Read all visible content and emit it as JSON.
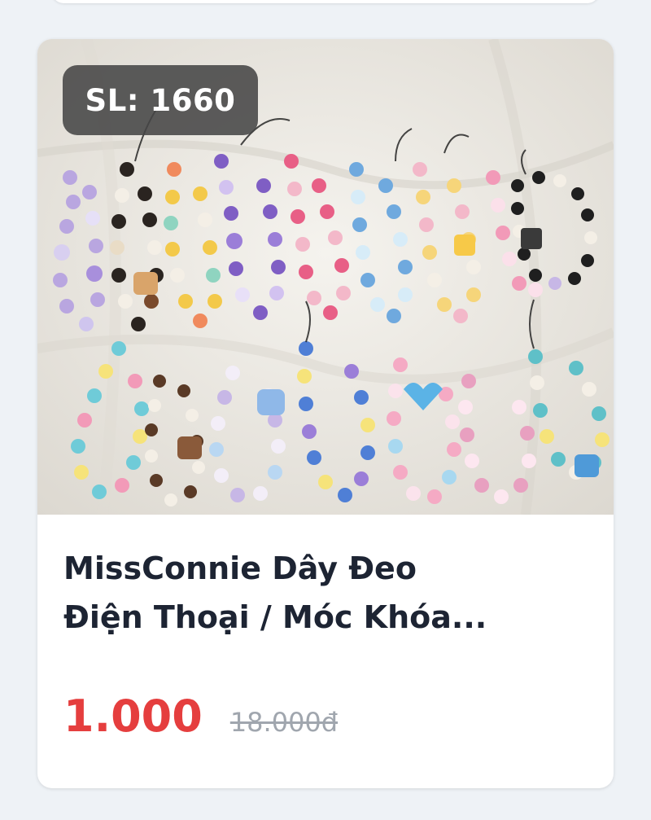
{
  "product": {
    "image_alt": "beaded phone strap collection",
    "quantity_badge": "SL: 1660",
    "title_line1": "MissConnie Dây Đeo",
    "title_line2": "Điện Thoại / Móc Khóa...",
    "sale_price": "1.000",
    "original_price": "18.000đ"
  },
  "colors": {
    "accent_price": "#e53e3e",
    "title_text": "#1d2433",
    "muted_text": "#a0a6ae",
    "badge_bg": "#464646",
    "page_bg": "#eef2f6"
  }
}
